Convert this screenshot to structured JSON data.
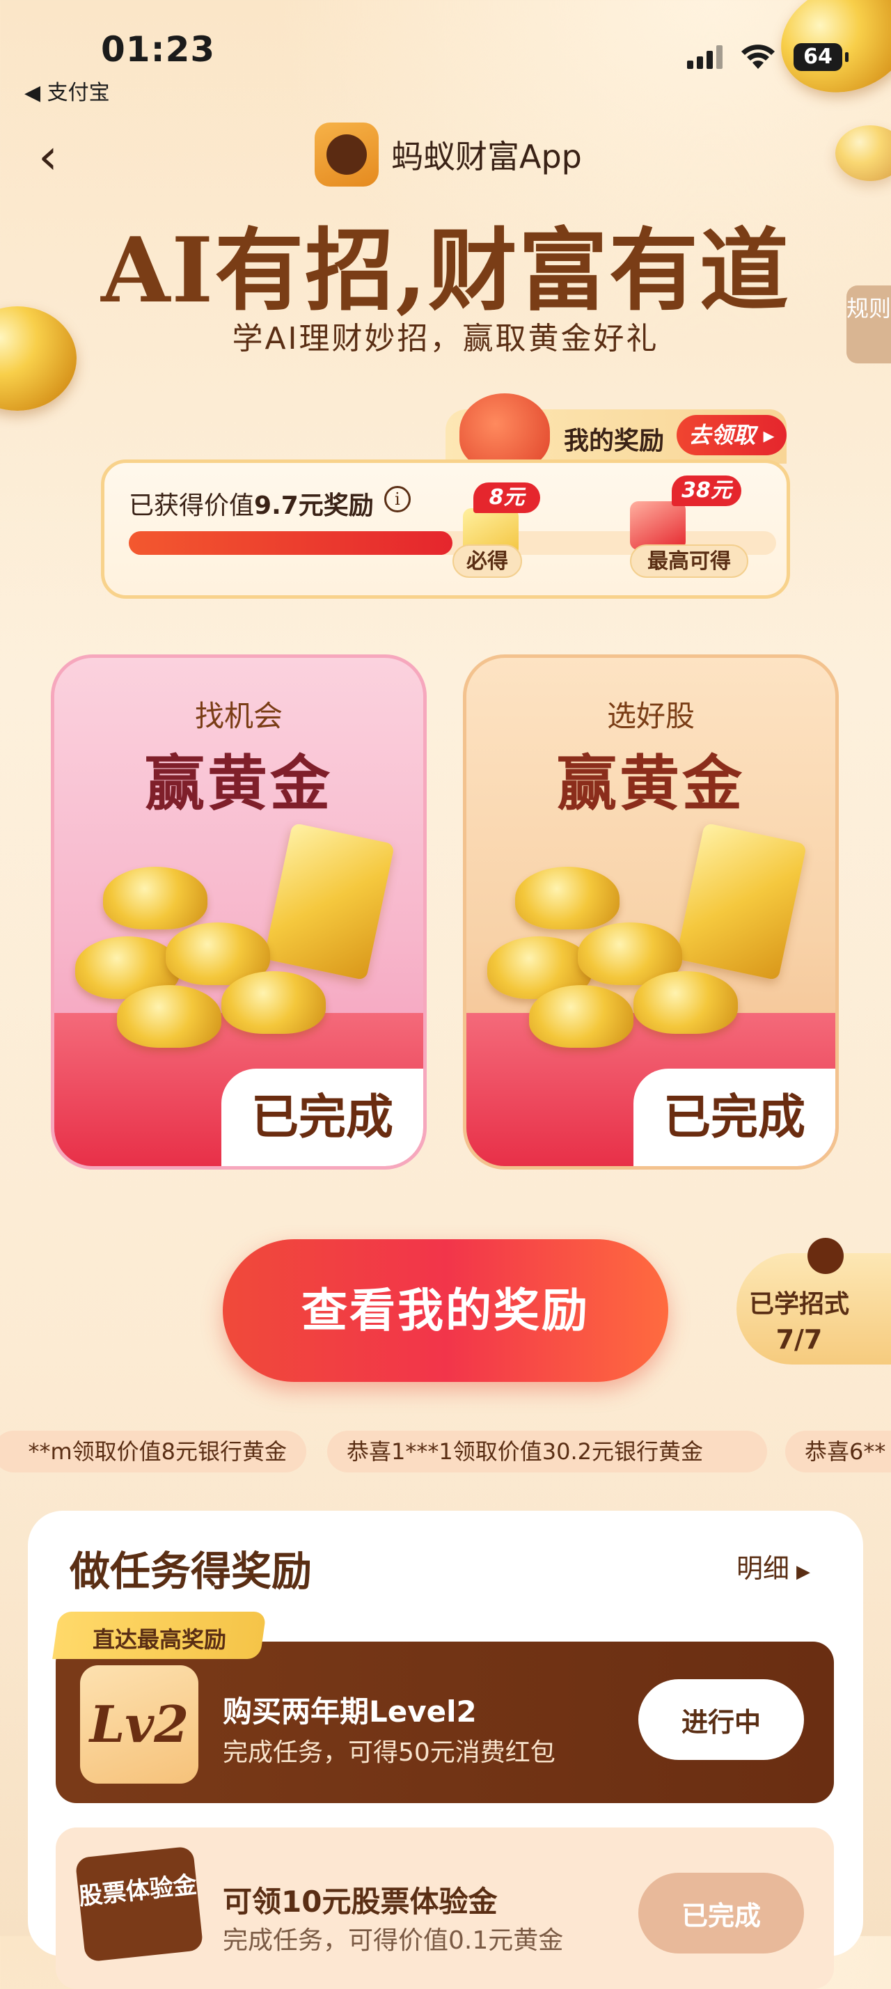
{
  "status_bar": {
    "time": "01:23",
    "back_app": "◀ 支付宝",
    "battery": "64"
  },
  "header": {
    "back_icon": "chevron-left-icon",
    "brand_name": "蚂蚁财富App",
    "title": "AI有招,财富有道",
    "subtitle": "学AI理财妙招，赢取黄金好礼",
    "rules_label": "规则"
  },
  "rewards": {
    "tab_label": "我的奖励",
    "claim_label": "去领取 ▸",
    "earned_prefix": "已获得价值",
    "earned_value": "9.7元奖励",
    "info_icon": "i",
    "progress_fraction": 0.5,
    "milestones": [
      {
        "tag": "8元",
        "label": "必得"
      },
      {
        "tag": "38元",
        "label": "最高可得"
      }
    ]
  },
  "cards": [
    {
      "sub": "找机会",
      "title": "赢黄金",
      "status": "已完成"
    },
    {
      "sub": "选好股",
      "title": "赢黄金",
      "status": "已完成"
    }
  ],
  "cta": {
    "label": "查看我的奖励"
  },
  "learned": {
    "line1": "已学招式",
    "line2": "7/7"
  },
  "ticker": [
    "**m领取价值8元银行黄金",
    "恭喜1***1领取价值30.2元银行黄金",
    "恭喜6**"
  ],
  "tasks": {
    "title": "做任务得奖励",
    "detail_label": "明细",
    "detail_icon": "▶",
    "items": [
      {
        "badge": "直达最高奖励",
        "icon_text": "Lv2",
        "name": "购买两年期Level2",
        "desc": "完成任务，可得50元消费红包",
        "button": "进行中"
      },
      {
        "icon_text": "股票体验金",
        "name": "可领10元股票体验金",
        "desc": "完成任务，可得价值0.1元黄金",
        "button": "已完成"
      }
    ]
  },
  "colors": {
    "accent_red": "#e5262d",
    "brown": "#5a2e14",
    "gold": "#f5c448"
  }
}
